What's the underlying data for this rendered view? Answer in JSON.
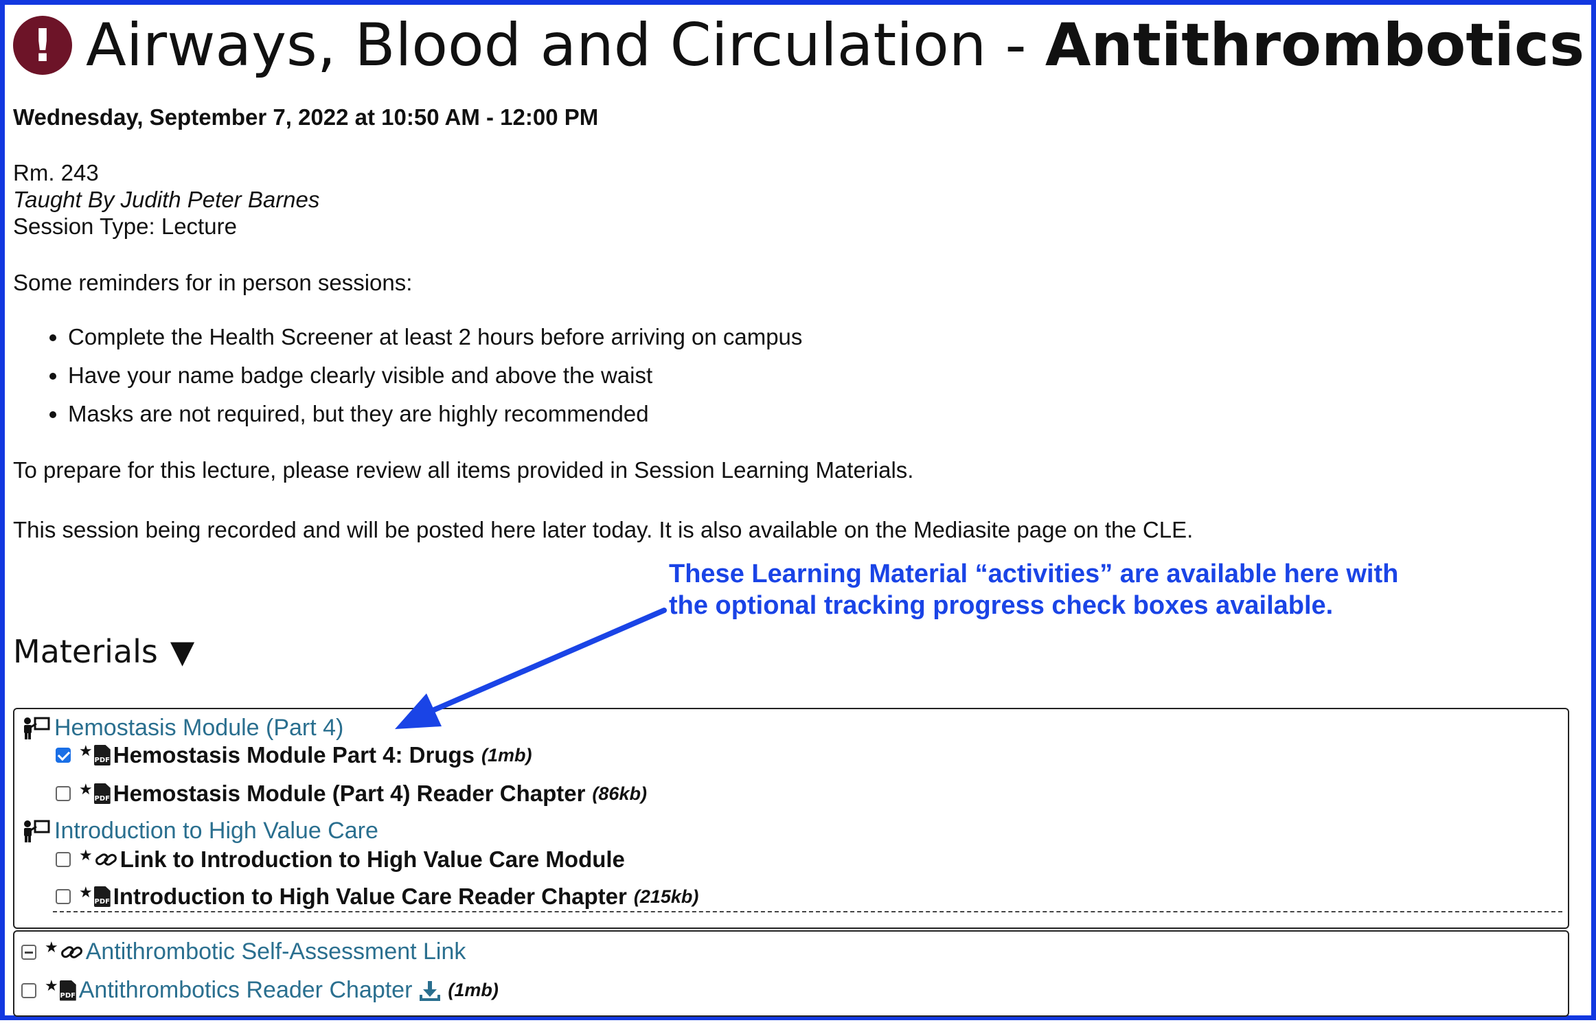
{
  "title": {
    "prefix": "Airways, Blood and Circulation - ",
    "bold": "Antithrombotics"
  },
  "session": {
    "datetime": "Wednesday, September 7, 2022 at 10:50 AM - 12:00 PM",
    "room": "Rm. 243",
    "taught_by": "Taught By Judith Peter Barnes",
    "type": "Session Type: Lecture"
  },
  "reminders": {
    "intro": "Some reminders for in person sessions:",
    "items": [
      "Complete the Health Screener at least 2 hours before arriving on campus",
      "Have your name badge clearly visible and above the waist",
      "Masks are not required, but they are highly recommended"
    ]
  },
  "prep_text": "To prepare for this lecture, please review all items provided in Session Learning Materials.",
  "recording_text": "This session being recorded and will be posted here later today. It is also available on the Mediasite page on the CLE.",
  "callout": {
    "line1": "These Learning Material “activities” are available here with",
    "line2": "the optional tracking progress check boxes available."
  },
  "materials": {
    "heading": "Materials",
    "toggle": "▼",
    "activities": [
      {
        "title": "Hemostasis Module (Part 4)",
        "items": [
          {
            "label": "Hemostasis Module Part 4: Drugs",
            "size": "(1mb)",
            "checked": true,
            "icon": "pdf-icon"
          },
          {
            "label": "Hemostasis Module (Part 4) Reader Chapter",
            "size": "(86kb)",
            "checked": false,
            "icon": "pdf-icon"
          }
        ]
      },
      {
        "title": "Introduction to High Value Care",
        "items": [
          {
            "label": "Link to Introduction to High Value Care Module",
            "size": "",
            "checked": false,
            "icon": "link-icon"
          },
          {
            "label": "Introduction to High Value Care Reader Chapter",
            "size": "(215kb)",
            "checked": false,
            "icon": "pdf-icon"
          }
        ]
      }
    ],
    "standalone": [
      {
        "label": "Antithrombotic Self-Assessment Link",
        "size": "",
        "state": "partial",
        "icon": "link-icon"
      },
      {
        "label": "Antithrombotics Reader Chapter",
        "size": "(1mb)",
        "state": "unchecked",
        "icon": "pdf-icon"
      }
    ],
    "star": "★",
    "pdf_badge": "PDF"
  },
  "colors": {
    "border": "#1238e0",
    "callout": "#1a44e6",
    "link": "#2a6f8f",
    "alert": "#6d1428",
    "checkbox": "#1a6fe6"
  }
}
